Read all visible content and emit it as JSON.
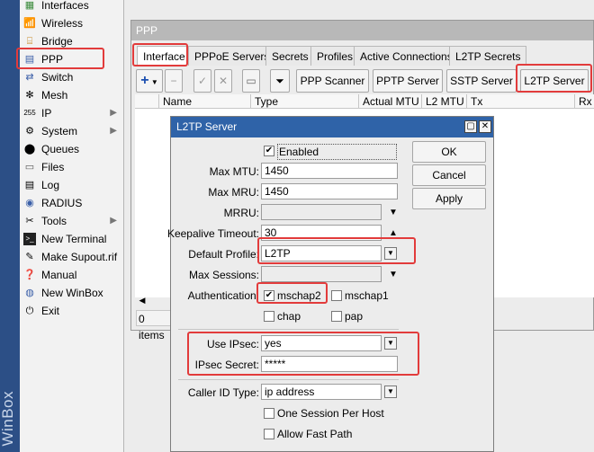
{
  "app": {
    "vertical_label": "WinBox"
  },
  "sidebar": {
    "items": [
      {
        "label": "Interfaces",
        "icon": "interfaces-icon"
      },
      {
        "label": "Wireless",
        "icon": "wireless-icon"
      },
      {
        "label": "Bridge",
        "icon": "bridge-icon"
      },
      {
        "label": "PPP",
        "icon": "ppp-icon"
      },
      {
        "label": "Switch",
        "icon": "switch-icon"
      },
      {
        "label": "Mesh",
        "icon": "mesh-icon"
      },
      {
        "label": "IP",
        "icon": "ip-icon"
      },
      {
        "label": "System",
        "icon": "system-icon"
      },
      {
        "label": "Queues",
        "icon": "queues-icon"
      },
      {
        "label": "Files",
        "icon": "files-icon"
      },
      {
        "label": "Log",
        "icon": "log-icon"
      },
      {
        "label": "RADIUS",
        "icon": "radius-icon"
      },
      {
        "label": "Tools",
        "icon": "tools-icon"
      },
      {
        "label": "New Terminal",
        "icon": "terminal-icon"
      },
      {
        "label": "Make Supout.rif",
        "icon": "supout-icon"
      },
      {
        "label": "Manual",
        "icon": "manual-icon"
      },
      {
        "label": "New WinBox",
        "icon": "winbox-icon"
      },
      {
        "label": "Exit",
        "icon": "exit-icon"
      }
    ]
  },
  "ppp_window": {
    "title": "PPP",
    "tabs": [
      "Interface",
      "PPPoE Servers",
      "Secrets",
      "Profiles",
      "Active Connections",
      "L2TP Secrets"
    ],
    "toolbar": {
      "add_symbol": "+",
      "buttons": [
        "PPP Scanner",
        "PPTP Server",
        "SSTP Server",
        "L2TP Server"
      ]
    },
    "columns": [
      "Name",
      "Type",
      "Actual MTU",
      "L2 MTU",
      "Tx",
      "Rx"
    ],
    "items_count": "0 items"
  },
  "dialog": {
    "title": "L2TP Server",
    "enabled_label": "Enabled",
    "max_mtu_label": "Max MTU:",
    "max_mtu": "1450",
    "max_mru_label": "Max MRU:",
    "max_mru": "1450",
    "mrru_label": "MRRU:",
    "mrru": "",
    "keepalive_label": "Keepalive Timeout:",
    "keepalive": "30",
    "default_profile_label": "Default Profile:",
    "default_profile": "L2TP",
    "max_sessions_label": "Max Sessions:",
    "max_sessions": "",
    "auth_label": "Authentication:",
    "auth": {
      "mschap2": "mschap2",
      "mschap1": "mschap1",
      "chap": "chap",
      "pap": "pap"
    },
    "use_ipsec_label": "Use IPsec:",
    "use_ipsec": "yes",
    "ipsec_secret_label": "IPsec Secret:",
    "ipsec_secret": "*****",
    "caller_id_label": "Caller ID Type:",
    "caller_id": "ip address",
    "one_session_label": "One Session Per Host",
    "allow_fast_path_label": "Allow Fast Path",
    "buttons": {
      "ok": "OK",
      "cancel": "Cancel",
      "apply": "Apply"
    }
  },
  "colors": {
    "highlight": "#e23b3b",
    "dialog_title": "#2f63a8",
    "winbox_strip": "#2c4f86"
  }
}
